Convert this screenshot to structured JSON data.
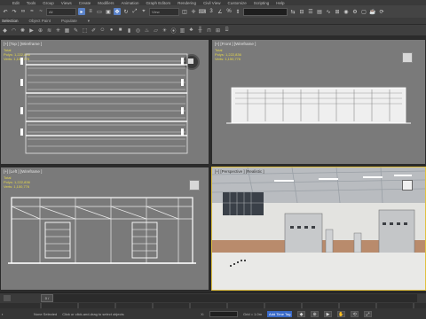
{
  "menu": {
    "items": [
      "Edit",
      "Tools",
      "Group",
      "Views",
      "Create",
      "Modifiers",
      "Animation",
      "Graph Editors",
      "Rendering",
      "Civil View",
      "Customize",
      "Scripting",
      "Help"
    ]
  },
  "toolbar": {
    "selection_filter": "All",
    "view_dropdown": "View"
  },
  "ribbon": {
    "tabs": [
      "Selection",
      "Object Paint",
      "Populate"
    ]
  },
  "viewports": {
    "top": {
      "label": "[+] [Top ] [Wireframe ]",
      "total_label": "Total",
      "polys": "Polys:  1,222,836",
      "verts": "Verts:  1,150,776"
    },
    "front": {
      "label": "[+] [Front ] [Wireframe ]",
      "total_label": "Total",
      "polys": "Polys:  1,222,836",
      "verts": "Verts:  1,150,776"
    },
    "left": {
      "label": "[+] [Left ] [Wireframe ]",
      "total_label": "Total",
      "polys": "Polys:  1,222,836",
      "verts": "Verts:  1,150,776"
    },
    "perspective": {
      "label": "[+] [Perspective ] [Realistic ]"
    }
  },
  "timeline": {
    "frame_display": "0 / 100"
  },
  "statusbar": {
    "selection_text": "None Selected",
    "prompt_text": "Click or click-and-drag to select objects",
    "x_value": "X:",
    "y_value": "Y:",
    "z_value": "Z:",
    "grid_value": "Grid = 1.0m",
    "add_time_tag": "Add Time Tag",
    "auto_key": "Auto Key",
    "set_key": "Set Key",
    "key_filters": "Selected"
  },
  "colors": {
    "viewport_bg": "#7a7a7a",
    "active_border": "#e0c040",
    "stats_yellow": "#e7d94a",
    "accent_blue": "#5a82c8"
  }
}
